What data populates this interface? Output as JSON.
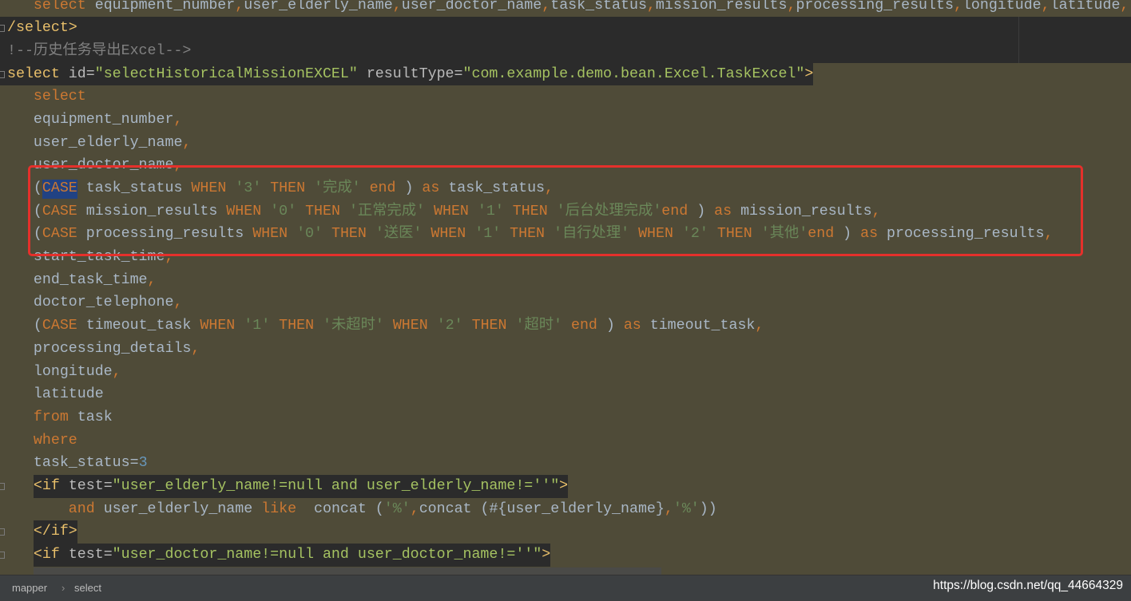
{
  "theme": {
    "keyword": "#cc7832",
    "identifier": "#a9b7c6",
    "string": "#6a8759",
    "number": "#6897bb",
    "xml_tag": "#e8bf6a",
    "xml_attribute": "#bababa",
    "xml_attribute_value": "#a5c261",
    "comment": "#808080",
    "selection": "#214283",
    "injected_fragment_background": "#4f4b38",
    "editor_background": "#2b2b2b",
    "annotation_box": "#e5302b"
  },
  "editor": {
    "lines": [
      [
        {
          "id": "   "
        },
        {
          "kw": "select"
        },
        {
          "id": " equipment_number"
        },
        {
          "kw": ","
        },
        {
          "id": "user_elderly_name"
        },
        {
          "kw": ","
        },
        {
          "id": "user_doctor_name"
        },
        {
          "kw": ","
        },
        {
          "id": "task_status"
        },
        {
          "kw": ","
        },
        {
          "id": "mission_results"
        },
        {
          "kw": ","
        },
        {
          "id": "processing_results"
        },
        {
          "kw": ","
        },
        {
          "id": "longitude"
        },
        {
          "kw": ","
        },
        {
          "id": "latitude"
        },
        {
          "kw": ","
        }
      ],
      [
        {
          "tag": "/select>"
        }
      ],
      [
        {
          "cm": "!--历史任务导出Excel-->"
        }
      ],
      [
        {
          "tag": "select"
        },
        {
          "attr": " id="
        },
        {
          "val": "\"selectHistoricalMissionEXCEL\""
        },
        {
          "attr": " resultType="
        },
        {
          "val": "\"com.example.demo.bean.Excel.TaskExcel\""
        },
        {
          "tag": ">"
        }
      ],
      [
        {
          "id": "   "
        },
        {
          "kw": "select"
        }
      ],
      [
        {
          "id": "   equipment_number"
        },
        {
          "kw": ","
        }
      ],
      [
        {
          "id": "   user_elderly_name"
        },
        {
          "kw": ","
        }
      ],
      [
        {
          "id": "   user_doctor_name"
        },
        {
          "kw": ","
        }
      ],
      [
        {
          "id": "   ("
        },
        {
          "sel": "CASE"
        },
        {
          "id": " task_status "
        },
        {
          "kw": "WHEN"
        },
        {
          "id": " "
        },
        {
          "str": "'3'"
        },
        {
          "id": " "
        },
        {
          "kw": "THEN"
        },
        {
          "id": " "
        },
        {
          "str": "'完成'"
        },
        {
          "id": " "
        },
        {
          "kw": "end"
        },
        {
          "id": " ) "
        },
        {
          "kw": "as"
        },
        {
          "id": " task_status"
        },
        {
          "kw": ","
        }
      ],
      [
        {
          "id": "   ("
        },
        {
          "kw": "CASE"
        },
        {
          "id": " mission_results "
        },
        {
          "kw": "WHEN"
        },
        {
          "id": " "
        },
        {
          "str": "'0'"
        },
        {
          "id": " "
        },
        {
          "kw": "THEN"
        },
        {
          "id": " "
        },
        {
          "str": "'正常完成'"
        },
        {
          "id": " "
        },
        {
          "kw": "WHEN"
        },
        {
          "id": " "
        },
        {
          "str": "'1'"
        },
        {
          "id": " "
        },
        {
          "kw": "THEN"
        },
        {
          "id": " "
        },
        {
          "str": "'后台处理完成'"
        },
        {
          "kw": "end"
        },
        {
          "id": " ) "
        },
        {
          "kw": "as"
        },
        {
          "id": " mission_results"
        },
        {
          "kw": ","
        }
      ],
      [
        {
          "id": "   ("
        },
        {
          "kw": "CASE"
        },
        {
          "id": " processing_results "
        },
        {
          "kw": "WHEN"
        },
        {
          "id": " "
        },
        {
          "str": "'0'"
        },
        {
          "id": " "
        },
        {
          "kw": "THEN"
        },
        {
          "id": " "
        },
        {
          "str": "'送医'"
        },
        {
          "id": " "
        },
        {
          "kw": "WHEN"
        },
        {
          "id": " "
        },
        {
          "str": "'1'"
        },
        {
          "id": " "
        },
        {
          "kw": "THEN"
        },
        {
          "id": " "
        },
        {
          "str": "'自行处理'"
        },
        {
          "id": " "
        },
        {
          "kw": "WHEN"
        },
        {
          "id": " "
        },
        {
          "str": "'2'"
        },
        {
          "id": " "
        },
        {
          "kw": "THEN"
        },
        {
          "id": " "
        },
        {
          "str": "'其他'"
        },
        {
          "kw": "end"
        },
        {
          "id": " ) "
        },
        {
          "kw": "as"
        },
        {
          "id": " processing_results"
        },
        {
          "kw": ","
        }
      ],
      [
        {
          "id": "   start_task_time"
        },
        {
          "kw": ","
        }
      ],
      [
        {
          "id": "   end_task_time"
        },
        {
          "kw": ","
        }
      ],
      [
        {
          "id": "   doctor_telephone"
        },
        {
          "kw": ","
        }
      ],
      [
        {
          "id": "   ("
        },
        {
          "kw": "CASE"
        },
        {
          "id": " timeout_task "
        },
        {
          "kw": "WHEN"
        },
        {
          "id": " "
        },
        {
          "str": "'1'"
        },
        {
          "id": " "
        },
        {
          "kw": "THEN"
        },
        {
          "id": " "
        },
        {
          "str": "'未超时'"
        },
        {
          "id": " "
        },
        {
          "kw": "WHEN"
        },
        {
          "id": " "
        },
        {
          "str": "'2'"
        },
        {
          "id": " "
        },
        {
          "kw": "THEN"
        },
        {
          "id": " "
        },
        {
          "str": "'超时'"
        },
        {
          "id": " "
        },
        {
          "kw": "end"
        },
        {
          "id": " ) "
        },
        {
          "kw": "as"
        },
        {
          "id": " timeout_task"
        },
        {
          "kw": ","
        }
      ],
      [
        {
          "id": "   processing_details"
        },
        {
          "kw": ","
        }
      ],
      [
        {
          "id": "   longitude"
        },
        {
          "kw": ","
        }
      ],
      [
        {
          "id": "   latitude"
        }
      ],
      [
        {
          "id": "   "
        },
        {
          "kw": "from"
        },
        {
          "id": " task"
        }
      ],
      [
        {
          "id": "   "
        },
        {
          "kw": "where"
        }
      ],
      [
        {
          "id": "   task_status="
        },
        {
          "num": "3"
        }
      ],
      [
        {
          "id": "   "
        },
        {
          "tag": "<if"
        },
        {
          "attr": " test="
        },
        {
          "val": "\"user_elderly_name!=null and user_elderly_name!=''\""
        },
        {
          "tag": ">"
        }
      ],
      [
        {
          "id": "       "
        },
        {
          "kw": "and"
        },
        {
          "id": " user_elderly_name "
        },
        {
          "kw": "like"
        },
        {
          "id": "  concat ("
        },
        {
          "str": "'%'"
        },
        {
          "kw": ","
        },
        {
          "id": "concat (#{user_elderly_name}"
        },
        {
          "kw": ","
        },
        {
          "str": "'%'"
        },
        {
          "id": "))"
        }
      ],
      [
        {
          "id": "   "
        },
        {
          "tag": "</if>"
        }
      ],
      [
        {
          "id": "   "
        },
        {
          "tag": "<if"
        },
        {
          "attr": " test="
        },
        {
          "val": "\"user_doctor_name!=null and user_doctor_name!=''\""
        },
        {
          "tag": ">"
        }
      ]
    ]
  },
  "statusbar": {
    "breadcrumb": [
      "mapper",
      "select"
    ],
    "separator": "›"
  },
  "watermark": "https://blog.csdn.net/qq_44664329"
}
